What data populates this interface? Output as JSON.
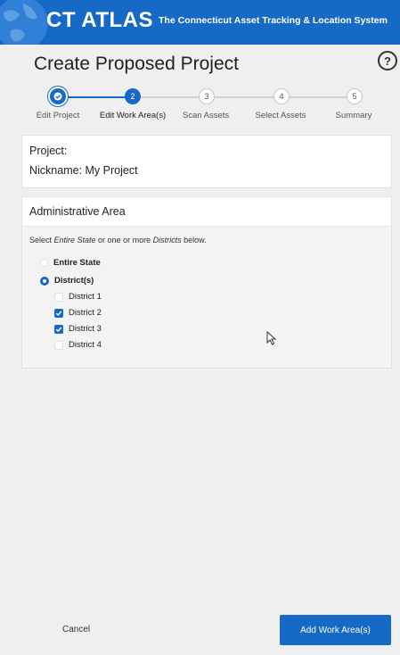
{
  "header": {
    "brand": "CT ATLAS",
    "tagline": "The Connecticut Asset Tracking & Location System",
    "background_color": "#1769c6"
  },
  "page": {
    "title": "Create Proposed Project",
    "help_glyph": "?"
  },
  "stepper": {
    "steps": [
      {
        "number": "1",
        "label": "Edit Project",
        "status": "complete",
        "icon": "check-icon"
      },
      {
        "number": "2",
        "label": "Edit Work Area(s)",
        "status": "current"
      },
      {
        "number": "3",
        "label": "Scan Assets",
        "status": "pending"
      },
      {
        "number": "4",
        "label": "Select Assets",
        "status": "pending"
      },
      {
        "number": "5",
        "label": "Summary",
        "status": "pending"
      }
    ]
  },
  "project": {
    "project_label": "Project:",
    "nickname_label": "Nickname: My Project"
  },
  "admin_area": {
    "heading": "Administrative Area",
    "instruction_prefix": "Select ",
    "instruction_em1": "Entire State",
    "instruction_mid": " or one or more ",
    "instruction_em2": "Districts",
    "instruction_suffix": " below.",
    "options": [
      {
        "label": "Entire State",
        "selected": false
      },
      {
        "label": "District(s)",
        "selected": true
      }
    ],
    "districts": [
      {
        "label": "District 1",
        "checked": false
      },
      {
        "label": "District 2",
        "checked": true
      },
      {
        "label": "District 3",
        "checked": true
      },
      {
        "label": "District 4",
        "checked": false
      }
    ]
  },
  "footer": {
    "cancel_label": "Cancel",
    "primary_label": "Add Work Area(s)"
  },
  "colors": {
    "accent": "#1769c6",
    "background": "#efefef"
  }
}
